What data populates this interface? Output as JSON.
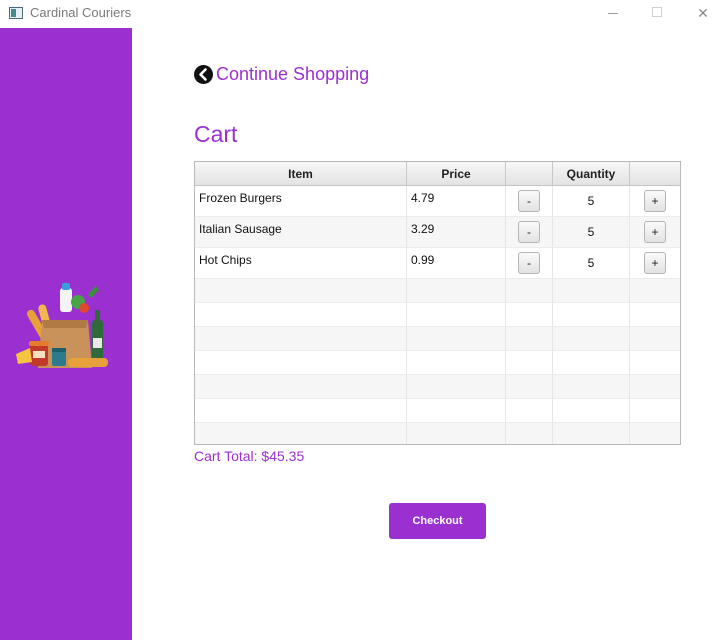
{
  "window": {
    "title": "Cardinal Couriers",
    "minimize_icon": "minimize-icon",
    "maximize_icon": "maximize-icon",
    "close_icon": "close-icon",
    "close_glyph": "✕"
  },
  "sidebar": {
    "color": "#9b30d0",
    "illustration": "grocery-bag-icon"
  },
  "nav": {
    "back_label": "Continue Shopping",
    "back_icon": "chevron-left-circle-icon"
  },
  "cart": {
    "title": "Cart",
    "columns": [
      "Item",
      "Price",
      "",
      "Quantity",
      ""
    ],
    "items": [
      {
        "name": "Frozen Burgers",
        "price": "4.79",
        "quantity": "5",
        "decrement_label": "-",
        "increment_label": "+"
      },
      {
        "name": "Italian Sausage",
        "price": "3.29",
        "quantity": "5",
        "decrement_label": "-",
        "increment_label": "+"
      },
      {
        "name": "Hot Chips",
        "price": "0.99",
        "quantity": "5",
        "decrement_label": "-",
        "increment_label": "+"
      }
    ],
    "total_label": "Cart Total: $45.35"
  },
  "checkout": {
    "label": "Checkout",
    "color": "#9b30d0"
  }
}
